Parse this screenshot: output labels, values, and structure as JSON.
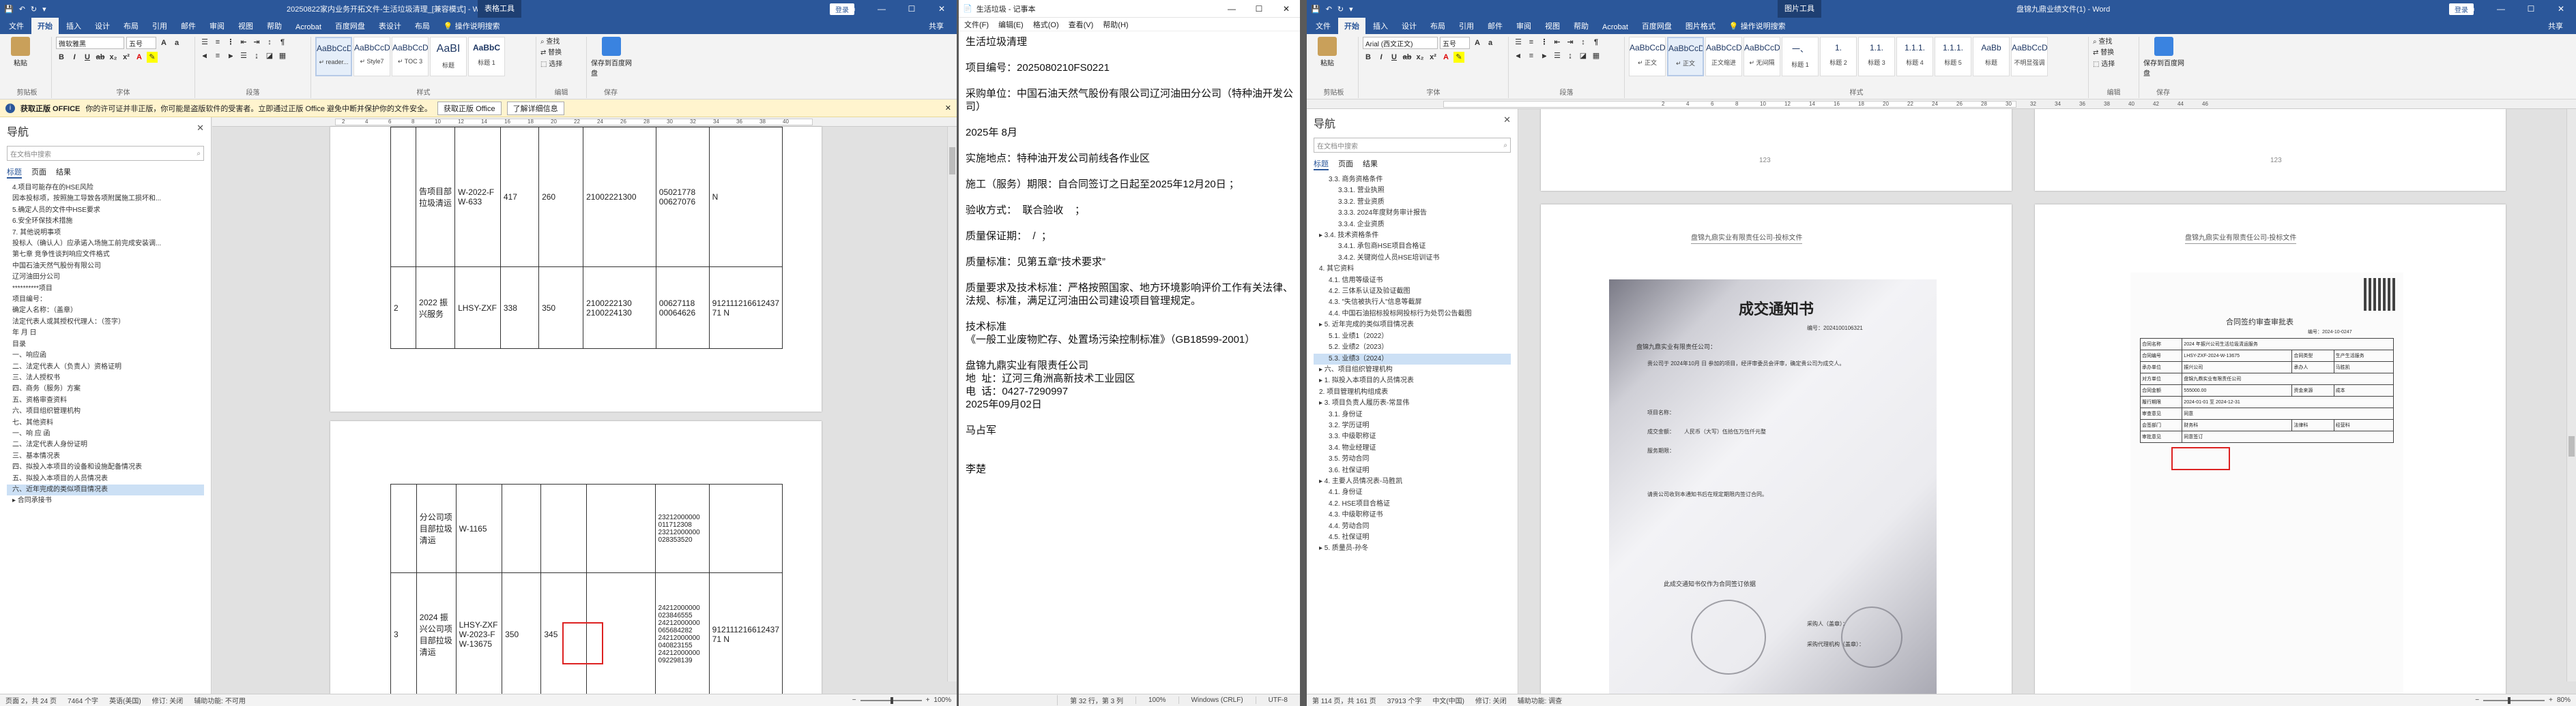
{
  "left_word": {
    "title": "20250822家内业务开拓文件-生活垃圾清理_[兼容模式] - Word",
    "context_tab": "表格工具",
    "login_label": "登录",
    "tabs": [
      "文件",
      "开始",
      "插入",
      "设计",
      "布局",
      "引用",
      "邮件",
      "审阅",
      "视图",
      "帮助",
      "Acrobat",
      "百度网盘",
      "表设计",
      "布局"
    ],
    "tell_me": "操作说明搜索",
    "share": "共享",
    "font_name": "微软雅黑",
    "font_size": "五号",
    "paste_label": "粘贴",
    "group_names": [
      "剪贴板",
      "字体",
      "段落",
      "样式",
      "编辑",
      "保存",
      "Adobe"
    ],
    "styles": [
      {
        "sample": "AaBbCcDc",
        "name": "↵ reader..."
      },
      {
        "sample": "AaBbCcDc",
        "name": "↵ Style7"
      },
      {
        "sample": "AaBbCcD",
        "name": "↵ TOC 3"
      },
      {
        "sample": "AaBI",
        "name": "标题"
      },
      {
        "sample": "AaBbC",
        "name": "标题 1"
      }
    ],
    "editing": [
      "查找",
      "替换",
      "选择"
    ],
    "save_baidu": "保存到百度网盘",
    "msgbar": {
      "prefix": "获取正版 OFFICE",
      "text": "你的许可证并非正版，你可能是盗版软件的受害者。立即通过正版 Office 避免中断并保护你的文件安全。",
      "btn1": "获取正版 Office",
      "btn2": "了解详细信息"
    },
    "nav": {
      "title": "导航",
      "search_placeholder": "在文档中搜索",
      "tabs": [
        "标题",
        "页面",
        "结果"
      ],
      "items": [
        "4.项目可能存在的HSE风险",
        "因本投标项，按照施工导致各项附属施工损坏和...",
        "5.确定人员的文件中HSE要求",
        "6.安全环保技术措施",
        "7. 其他说明事项",
        "投标人（确认人）应承诺入场施工前完成安装调...",
        "第七章 竞争性谈判响应文件格式",
        "中国石油天然气股份有限公司",
        "辽河油田分公司",
        "**********项目",
        "项目编号：",
        "确定人名称：（盖章）",
        "法定代表人或其授权代理人：（签字）",
        "年 月 日",
        "目录",
        "一、响应函",
        "二、法定代表人（负责人）资格证明",
        "三、法人授权书",
        "四、商务（服务）方案",
        "五、资格审查资料",
        "六、项目组织管理机构",
        "七、其他资料",
        "一、响 应 函",
        "二、法定代表人身份证明",
        "三、基本情况表",
        "四、拟投入本项目的设备和设施配备情况表",
        "五、拟投入本项目的人员情况表",
        "六、近年完成的类似项目情况表",
        "▸ 合同承接书"
      ],
      "highlight_index": 27
    },
    "ruler_marks": [
      "2",
      "4",
      "6",
      "8",
      "10",
      "12",
      "14",
      "16",
      "18",
      "20",
      "22",
      "24",
      "26",
      "28",
      "30",
      "32",
      "34",
      "36",
      "38",
      "40"
    ],
    "page1_rows": [
      {
        "c1": "",
        "c2": "告项目部拉圾清运",
        "c3": "W-2022-F W-633",
        "c4": "417",
        "c5": "260",
        "c6": "21002221300",
        "c7": "05021778 00627076",
        "c8": "N"
      },
      {
        "c1": "2",
        "c2": "2022 振兴服务",
        "c3": "LHSY-ZXF",
        "c4": "338",
        "c5": "350",
        "c6": "2100222130 2100224130",
        "c7": "00627118 00064626",
        "c8": "912111216612437 71 N"
      }
    ],
    "page2_rows": [
      {
        "c2": "分公司项目部拉圾清运",
        "c3": "W-1165",
        "c7": "23212000000 011712308 23212000000 028353520"
      },
      {
        "c1": "3",
        "c2": "2024 振兴公司项目部拉圾清运",
        "c3": "LHSY-ZXF W-2023-F W-13675",
        "c4": "350",
        "c5": "345",
        "c7": "24212000000 023846555 24212000000 065684282 24212000000 040823155 24212000000 092298139",
        "c8": "912111216612437 71 N"
      }
    ],
    "status": {
      "page": "页面 2，共 24 页",
      "words": "7464 个字",
      "lang": "英语(美国)",
      "revisions": "修订: 关闭",
      "accessibility": "辅助功能: 不可用",
      "zoom": "100%"
    }
  },
  "notepad": {
    "title": "生活垃圾 - 记事本",
    "menu": [
      "文件(F)",
      "编辑(E)",
      "格式(O)",
      "查看(V)",
      "帮助(H)"
    ],
    "lines": [
      "生活垃圾清理",
      "",
      "项目编号：2025080210FS0221",
      "",
      "采购单位：中国石油天然气股份有限公司辽河油田分公司（特种油开发公司）",
      "",
      "2025年 8月",
      "",
      "实施地点：特种油开发公司前线各作业区",
      "",
      "施工（服务）期限：自合同签订之日起至2025年12月20日 ；",
      "",
      "验收方式：  联合验收    ；",
      "",
      "质量保证期：  /  ；",
      "",
      "质量标准：见第五章“技术要求”",
      "",
      "质量要求及技术标准：严格按照国家、地方环境影响评价工作有关法律、法规、标准，满足辽河油田公司建设项目管理规定。",
      "",
      "技术标准",
      "《一般工业废物贮存、处置场污染控制标准》（GB18599-2001）",
      "",
      "盘锦九鼎实业有限责任公司",
      "地  址：辽河三角洲高新技术工业园区",
      "电  话：0427-7290997",
      "2025年09月02日",
      "",
      "马占军",
      "",
      "",
      "李楚"
    ],
    "status": {
      "pos": "第 32 行，第 3 列",
      "zoom": "100%",
      "eol": "Windows (CRLF)",
      "enc": "UTF-8"
    }
  },
  "right_word": {
    "title": "盘锦九鼎业绩文件(1) - Word",
    "context_tab": "图片工具",
    "login_label": "登录",
    "tabs": [
      "文件",
      "开始",
      "插入",
      "设计",
      "布局",
      "引用",
      "邮件",
      "审阅",
      "视图",
      "帮助",
      "Acrobat",
      "百度网盘",
      "图片格式"
    ],
    "tell_me": "操作说明搜索",
    "share": "共享",
    "font_name": "Arial (西文正文)",
    "font_size": "五号",
    "paste_label": "粘贴",
    "group_names": [
      "剪贴板",
      "字体",
      "段落",
      "样式",
      "编辑",
      "保存",
      "Adobe"
    ],
    "styles": [
      {
        "sample": "AaBbCcD",
        "name": "↵ 正文"
      },
      {
        "sample": "AaBbCcD",
        "name": "↵ 正文"
      },
      {
        "sample": "AaBbCcD",
        "name": "正文缩进"
      },
      {
        "sample": "AaBbCcD",
        "name": "↵ 无间隔"
      },
      {
        "sample": "一、",
        "name": "标题 1"
      },
      {
        "sample": "1.",
        "name": "标题 2"
      },
      {
        "sample": "1.1.",
        "name": "标题 3"
      },
      {
        "sample": "1.1.1.",
        "name": "标题 4"
      },
      {
        "sample": "1.1.1.",
        "name": "标题 5"
      },
      {
        "sample": "AaBb",
        "name": "标题"
      },
      {
        "sample": "AaBbCcD",
        "name": "不明显强调"
      }
    ],
    "editing": [
      "查找",
      "替换",
      "选择"
    ],
    "save_baidu": "保存到百度网盘",
    "nav": {
      "title": "导航",
      "search_placeholder": "在文档中搜索",
      "tabs": [
        "标题",
        "页面",
        "结果"
      ],
      "items": [
        "3.3. 商务资格条件",
        "3.3.1. 营业执照",
        "3.3.2. 营业资质",
        "3.3.3. 2024年度财务审计报告",
        "3.3.4. 企业资质",
        "▸ 3.4. 技术资格条件",
        "3.4.1. 承包商HSE项目合格证",
        "3.4.2. 关键岗位人员HSE培训证书",
        "4. 其它资料",
        "4.1. 信用等级证书",
        "4.2. 三体系认证及验证截图",
        "4.3. \"失信被执行人\"信息等截屏",
        "4.4. 中国石油招标投标网投标行为处罚公告截图",
        "▸ 5. 近年完成的类似项目情况表",
        "5.1. 业绩1（2022）",
        "5.2. 业绩2（2023）",
        "5.3. 业绩3（2024）",
        "▸ 六、项目组织管理机构",
        "▸ 1. 拟投入本项目的人员情况表",
        "2. 项目管理机构组成表",
        "▸ 3. 项目负责人履历表-常显伟",
        "3.1. 身份证",
        "3.2. 学历证明",
        "3.3. 中级职称证",
        "3.4. 物业经理证",
        "3.5. 劳动合同",
        "3.6. 社保证明",
        "▸ 4. 主要人员情况表-马胜凯",
        "4.1. 身份证",
        "4.2. HSE项目合格证",
        "4.3. 中级职称证书",
        "4.4. 劳动合同",
        "4.5. 社保证明",
        "▸ 5. 质量员-孙冬"
      ],
      "highlight_index": 16
    },
    "ruler_marks": [
      "2",
      "4",
      "6",
      "8",
      "10",
      "12",
      "14",
      "16",
      "18",
      "20",
      "22",
      "24",
      "26",
      "28",
      "30",
      "32",
      "34",
      "36",
      "38",
      "40",
      "42",
      "44",
      "46"
    ],
    "page_numbers": [
      "123",
      "123"
    ],
    "left_page": {
      "header": "盘锦九鼎实业有限责任公司-投标文件",
      "notice_title": "成交通知书",
      "notice_no": "编号：2024100106321",
      "recipient": "盘锦九鼎实业有限责任公司：",
      "body1": "贵公司于 2024年10月 日 参加的项目，经评审委员会评审，确定贵公司为成交人。",
      "project_label": "项目名称：",
      "amount_label": "成交金额：",
      "amount": "人民币（大写）伍拾伍万伍仟元整",
      "period_label": "服务期限：",
      "footer1": "请贵公司收到本通知书后在规定期限内签订合同。",
      "footer2": "此成交通知书仅作为合同签订依据",
      "signer1": "采购人（盖章）：",
      "signer2": "采购代理机构（盖章）："
    },
    "right_page": {
      "header": "盘锦九鼎实业有限责任公司-投标文件",
      "form_title": "合同签约审查审批表",
      "form_no": "编号：2024-10-0247",
      "rows": [
        [
          "合同名称",
          "2024 年振兴公司生活垃圾清运服务"
        ],
        [
          "合同编号",
          "LHSY-ZXF-2024-W-13675",
          "合同类型",
          "生产生活服务"
        ],
        [
          "承办单位",
          "振兴公司",
          "承办人",
          "马胜凯"
        ],
        [
          "对方单位",
          "盘锦九鼎实业有限责任公司"
        ],
        [
          "合同金额",
          "555000.00",
          "资金来源",
          "成本"
        ],
        [
          "履行期限",
          "2024-01-01 至 2024-12-31"
        ],
        [
          "审查意见",
          "同意"
        ],
        [
          "会签部门",
          "财务科",
          "法律科",
          "经营科"
        ],
        [
          "审批意见",
          "同意签订"
        ]
      ]
    },
    "status": {
      "page": "第 114 页，共 161 页",
      "words": "37913 个字",
      "lang": "中文(中国)",
      "revisions": "修订: 关闭",
      "accessibility": "辅助功能: 调查",
      "zoom": "80%"
    }
  }
}
